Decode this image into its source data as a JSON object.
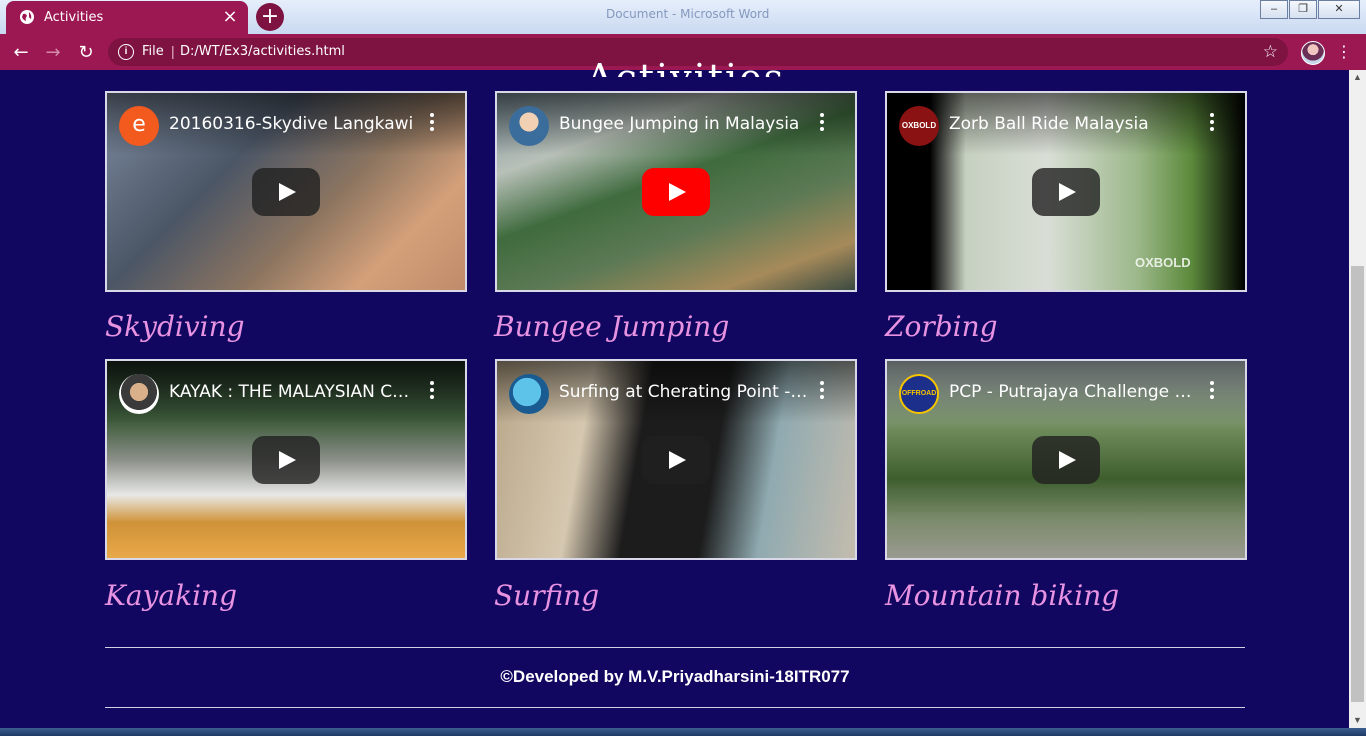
{
  "browser": {
    "tab_title": "Activities",
    "background_window_title": "Document - Microsoft Word",
    "url_scheme_label": "File",
    "url": "D:/WT/Ex3/activities.html",
    "theme_color": "#9c1852"
  },
  "page": {
    "heading": "Activities",
    "background_color": "#120760",
    "caption_color": "#e893e2",
    "videos": [
      {
        "title": "20160316-Skydive Langkawi",
        "caption": "Skydiving",
        "channel_icon": "letter-e-avatar",
        "channel_letter": "e"
      },
      {
        "title": "Bungee Jumping in Malaysia",
        "caption": "Bungee Jumping",
        "channel_icon": "person-avatar"
      },
      {
        "title": "Zorb Ball Ride Malaysia",
        "caption": "Zorbing",
        "channel_icon": "oxbold-logo",
        "watermark": "OXBOLD"
      },
      {
        "title": "KAYAK : THE MALAYSIAN CHALLENGE",
        "caption": "Kayaking",
        "channel_icon": "person-avatar"
      },
      {
        "title": "Surfing at Cherating Point - Malaysia",
        "caption": "Surfing",
        "channel_icon": "globe-avatar"
      },
      {
        "title": "PCP - Putrajaya Challenge Park",
        "caption": "Mountain biking",
        "channel_icon": "offroad-logo"
      }
    ],
    "footer": "©Developed by M.V.Priyadharsini-18ITR077"
  }
}
